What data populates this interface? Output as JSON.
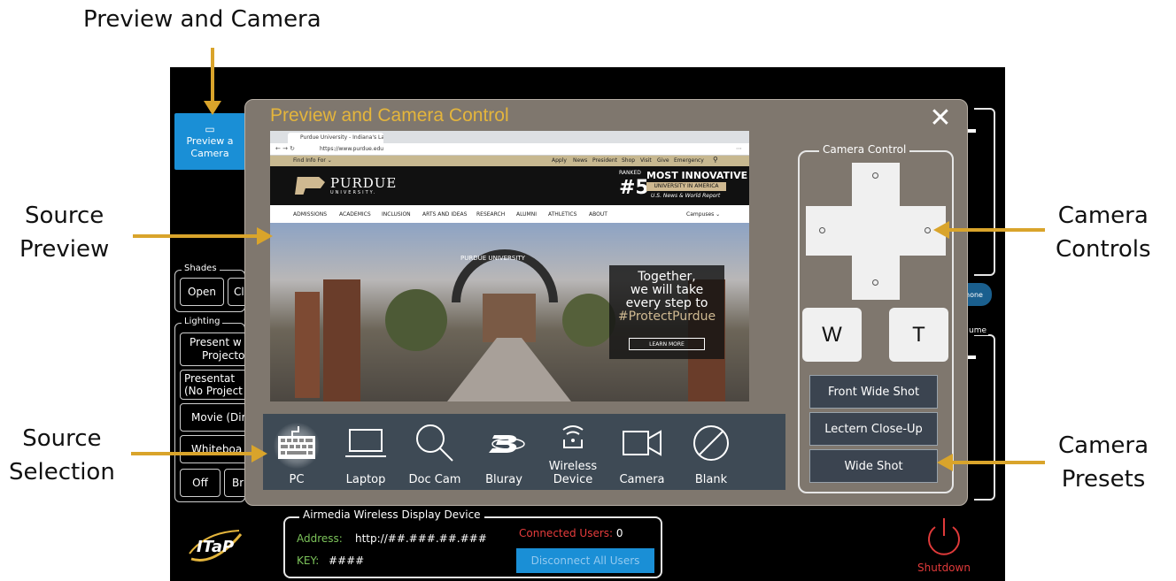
{
  "annotations": {
    "preview_and_camera": "Preview and Camera",
    "source_preview_line1": "Source",
    "source_preview_line2": "Preview",
    "source_selection_line1": "Source",
    "source_selection_line2": "Selection",
    "camera_controls_line1": "Camera",
    "camera_controls_line2": "Controls",
    "camera_presets_line1": "Camera",
    "camera_presets_line2": "Presets"
  },
  "colors": {
    "accent_gold": "#e4b53c",
    "arrow": "#d9a42b",
    "panel_bg": "#000000",
    "modal_bg": "#7f776e",
    "preset_bg": "#3b4450",
    "disconnect_bg": "#1a8fd6",
    "shutdown_red": "#e03a3a",
    "preview_camera_button": "#1a8fd6"
  },
  "background_panel": {
    "preview_button_line1": "Preview a",
    "preview_button_line2": "Camera",
    "shades_label": "Shades",
    "shades_open": "Open",
    "shades_close_partial": "Cl",
    "lighting_label": "Lighting",
    "lighting_1_line1": "Present w",
    "lighting_1_line2": "Projecto",
    "lighting_2_line1": "Presentat",
    "lighting_2_line2": "(No Project",
    "lighting_3": "Movie (Dir",
    "lighting_4": "Whiteboa",
    "lighting_off": "Off",
    "lighting_br_partial": "Br",
    "phone_partial": "hone",
    "volume_partial": "ume"
  },
  "modal": {
    "title": "Preview and Camera Control",
    "close_icon": "close-icon"
  },
  "browser": {
    "tab_title": "Purdue University - Indiana's La",
    "url": "https://www.purdue.edu",
    "topbar": {
      "find_info": "Find Info For ⌄",
      "links": [
        "Apply",
        "News",
        "President",
        "Shop",
        "Visit",
        "Give",
        "Emergency"
      ]
    },
    "logo_name": "PURDUE",
    "logo_sub": "UNIVERSITY.",
    "ranked": "RANKED",
    "rank_number": "#5",
    "innovative": "MOST INNOVATIVE",
    "innovative_band": "UNIVERSITY IN AMERICA",
    "usnews": "U.S. News & World Report",
    "nav": [
      "ADMISSIONS",
      "ACADEMICS",
      "INCLUSION",
      "ARTS AND IDEAS",
      "RESEARCH",
      "ALUMNI",
      "ATHLETICS",
      "ABOUT"
    ],
    "campuses": "Campuses ⌄",
    "gate_sign": "PURDUE UNIVERSITY",
    "hero_line1": "Together,",
    "hero_line2": "we will take",
    "hero_line3": "every step to",
    "hero_line4": "#ProtectPurdue",
    "hero_button": "LEARN MORE"
  },
  "sources": [
    {
      "label": "PC",
      "icon": "keyboard-icon",
      "selected": true
    },
    {
      "label": "Laptop",
      "icon": "laptop-icon",
      "selected": false
    },
    {
      "label": "Doc Cam",
      "icon": "magnifier-icon",
      "selected": false
    },
    {
      "label": "Bluray",
      "icon": "bluray-icon",
      "selected": false
    },
    {
      "label_line1": "Wireless",
      "label_line2": "Device",
      "icon": "wireless-icon",
      "selected": false
    },
    {
      "label": "Camera",
      "icon": "video-camera-icon",
      "selected": false
    },
    {
      "label": "Blank",
      "icon": "blank-icon",
      "selected": false
    }
  ],
  "camera": {
    "group_label": "Camera Control",
    "zoom_wide": "W",
    "zoom_tele": "T",
    "presets": [
      "Front Wide Shot",
      "Lectern Close-Up",
      "Wide Shot"
    ]
  },
  "airmedia": {
    "group_label": "Airmedia Wireless Display Device",
    "address_key": "Address:",
    "address_value": "http://##.###.##.###",
    "key_key": "KEY:",
    "key_value": "####",
    "connected_users_label": "Connected Users:",
    "connected_users_value": "0",
    "disconnect_button": "Disconnect All Users"
  },
  "logo_text": "ITaP",
  "shutdown_label": "Shutdown"
}
